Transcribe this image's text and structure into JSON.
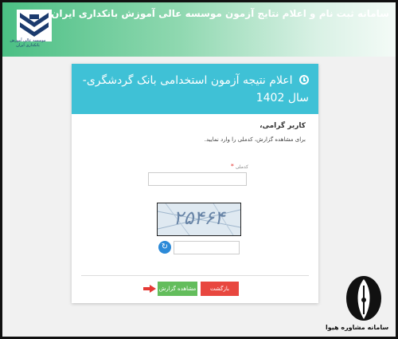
{
  "header": {
    "title": "سامانه ثبت نام و اعلام نتایج آزمون موسسه عالی آموزش بانکداری ایران",
    "logo_caption": "موسسه عالی آموزش بانکداری ایران"
  },
  "card": {
    "title": "اعلام نتیجه آزمون استخدامی بانک گردشگری- سال 1402",
    "greeting": "کاربر گرامی،",
    "instruction": "برای مشاهده گزارش، کدملی را وارد نمایید.",
    "national_code_label": "کدملی",
    "required_mark": "*",
    "national_code_value": "",
    "captcha_text": "۲۵۴۶۴",
    "captcha_input_value": ""
  },
  "buttons": {
    "back": "بازگشت",
    "view_report": "مشاهده گزارش"
  },
  "icons": {
    "title": "clock-icon",
    "refresh": "refresh-icon",
    "pointer": "arrow-right-icon",
    "brand": "fountain-pen-icon"
  },
  "colors": {
    "header_green": "#4bbf84",
    "card_head": "#3fc1d6",
    "back_button": "#e8473f",
    "view_button": "#63bd5c",
    "arrow": "#e53935"
  },
  "watermark": {
    "text": "سامانه مشاوره هیوا"
  }
}
